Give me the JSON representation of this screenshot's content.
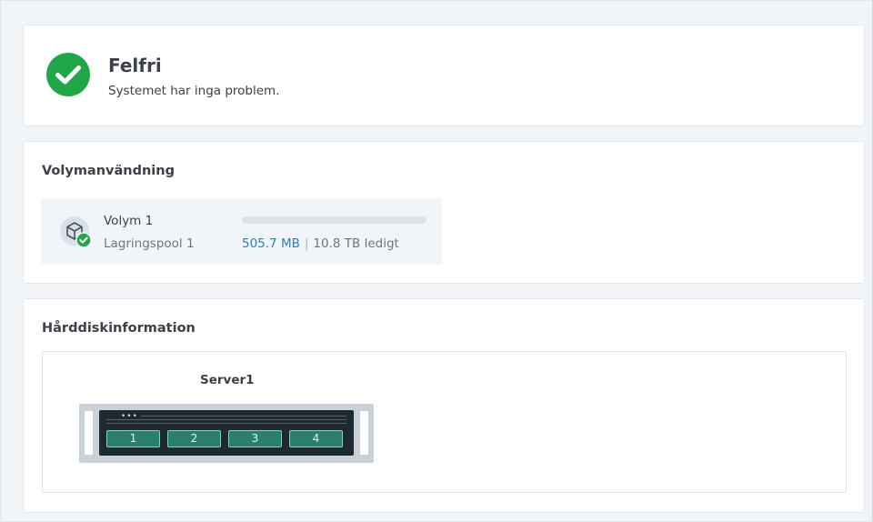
{
  "status": {
    "title": "Felfri",
    "subtitle": "Systemet har inga problem.",
    "icon": "check-circle-icon",
    "color": "#1fa74a"
  },
  "volume_section": {
    "title": "Volymanvändning",
    "volume": {
      "name": "Volym 1",
      "pool": "Lagringspool 1",
      "used": "505.7 MB",
      "separator": "|",
      "free": "10.8 TB ledigt",
      "used_fraction": 0.0,
      "icon": "volume-cube-icon",
      "status_icon": "check-badge-icon",
      "accent_color": "#2e7fb4"
    }
  },
  "disk_section": {
    "title": "Hårddiskinformation",
    "server": {
      "name": "Server1",
      "leds": "•••",
      "bays": [
        "1",
        "2",
        "3",
        "4"
      ],
      "bay_color": "#2a7f6e"
    }
  }
}
